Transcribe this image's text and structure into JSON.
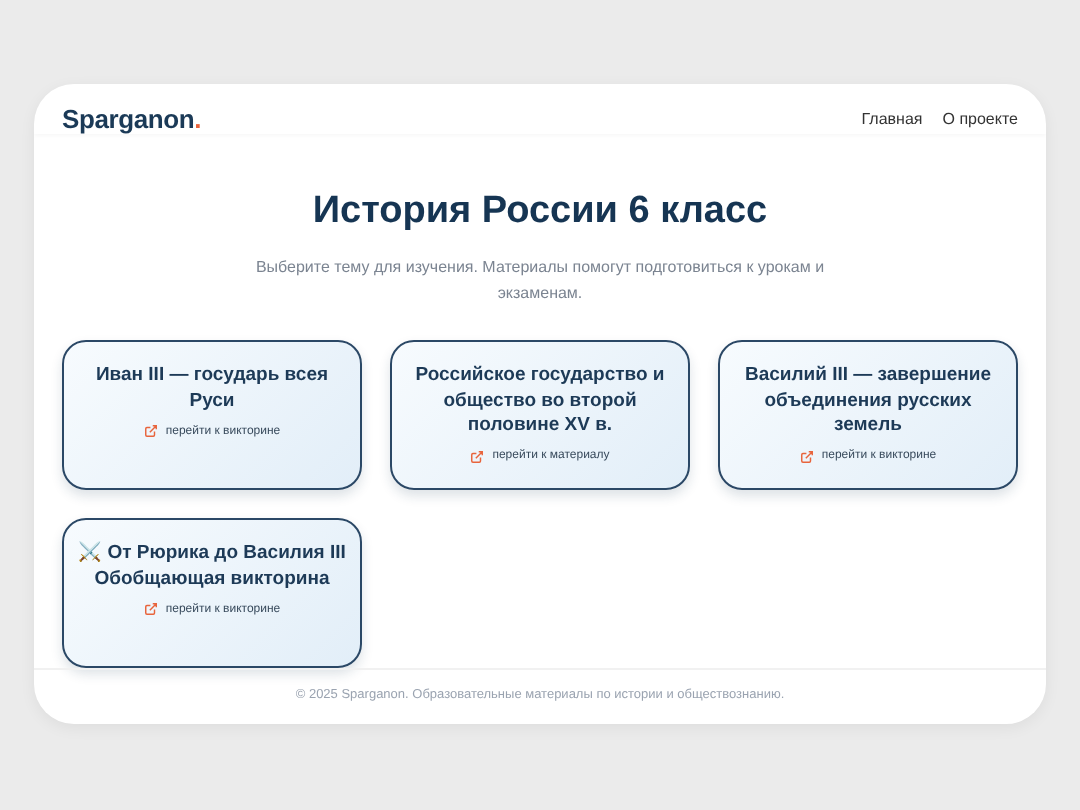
{
  "header": {
    "logo": "Sparganon",
    "logo_dot": ".",
    "nav": [
      "Главная",
      "О проекте"
    ]
  },
  "hero": {
    "title": "История России 6 класс",
    "subtitle": "Выберите тему для изучения. Материалы помогут подготовиться к урокам и экзаменам."
  },
  "cards": [
    {
      "title": "Иван III — государь всея Руси",
      "link": "перейти к викторине"
    },
    {
      "title": "Российское государство и общество во второй половине XV в.",
      "link": "перейти к материалу"
    },
    {
      "title": "Василий III — завершение объединения русских земель",
      "link": "перейти к викторине"
    },
    {
      "title": "⚔️ От Рюрика до Василия III Обобщающая викторина",
      "link": "перейти к викторине"
    }
  ],
  "footer": "© 2025 Sparganon. Образовательные материалы по истории и обществознанию."
}
